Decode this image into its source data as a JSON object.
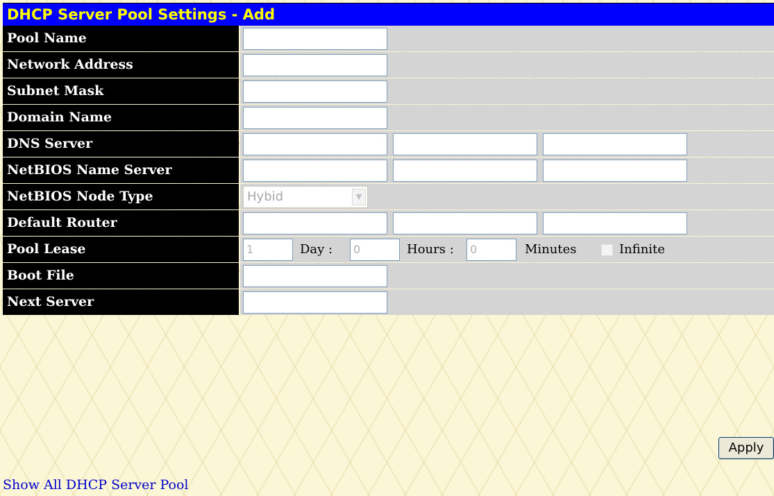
{
  "title": "DHCP Server Pool Settings - Add",
  "fields": {
    "pool_name": "Pool Name",
    "network_address": "Network Address",
    "subnet_mask": "Subnet Mask",
    "domain_name": "Domain Name",
    "dns_server": "DNS Server",
    "netbios_name_server": "NetBIOS Name Server",
    "netbios_node_type": "NetBIOS Node Type",
    "default_router": "Default Router",
    "pool_lease": "Pool Lease",
    "boot_file": "Boot File",
    "next_server": "Next Server"
  },
  "node_type_value": "Hybid",
  "lease": {
    "day_value": "1",
    "day_label": "Day :",
    "hours_value": "0",
    "hours_label": "Hours :",
    "minutes_value": "0",
    "minutes_label": "Minutes",
    "infinite_label": "Infinite"
  },
  "apply_label": "Apply",
  "link_text": "Show All DHCP Server Pool"
}
